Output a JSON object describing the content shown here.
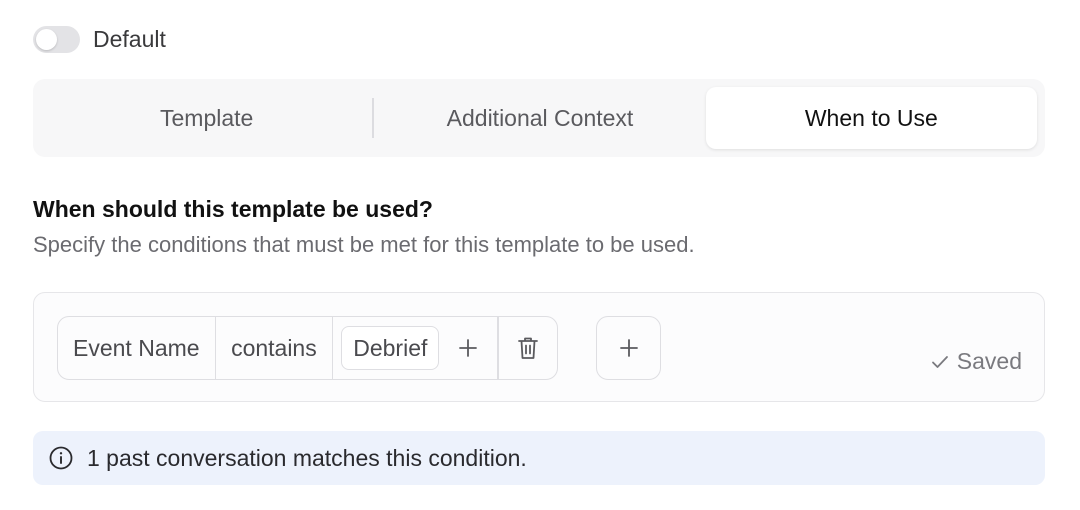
{
  "toggle": {
    "label": "Default",
    "on": false
  },
  "tabs": [
    {
      "label": "Template",
      "active": false
    },
    {
      "label": "Additional Context",
      "active": false
    },
    {
      "label": "When to Use",
      "active": true
    }
  ],
  "section": {
    "title": "When should this template be used?",
    "description": "Specify the conditions that must be met for this template to be used."
  },
  "condition": {
    "field": "Event Name",
    "operator": "contains",
    "value": "Debrief"
  },
  "status": {
    "saved_label": "Saved"
  },
  "info": {
    "text": "1 past conversation matches this condition."
  },
  "colors": {
    "tab_bg": "#f7f7f8",
    "info_bg": "#edf2fc",
    "toggle_off": "#e3e3e6"
  }
}
